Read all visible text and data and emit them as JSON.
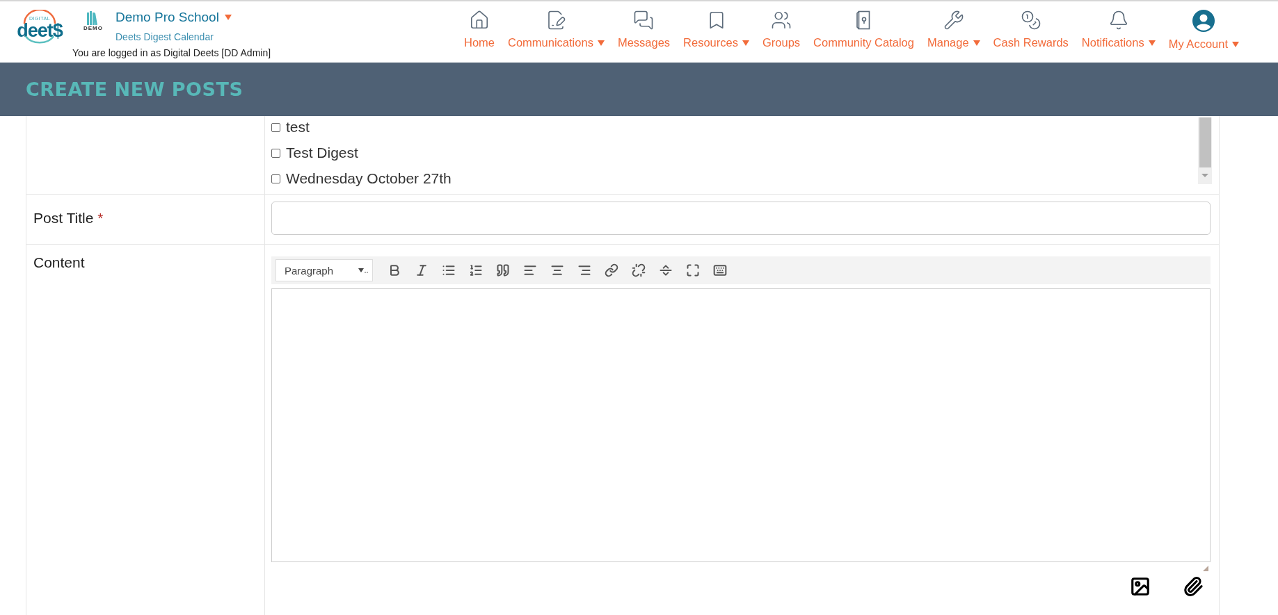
{
  "brand": {
    "logo_small": "DIGITAL",
    "logo_main": "deet$",
    "org_logo": "DEMO"
  },
  "header": {
    "school": "Demo Pro School",
    "school_dropdown": true,
    "subtitle": "Deets Digest Calendar",
    "login_note": "You are logged in as Digital Deets [DD Admin]"
  },
  "nav": [
    {
      "kind": "home",
      "label": "Home",
      "dropdown": false
    },
    {
      "kind": "communications",
      "label": "Communications",
      "dropdown": true
    },
    {
      "kind": "messages",
      "label": "Messages",
      "dropdown": false
    },
    {
      "kind": "resources",
      "label": "Resources",
      "dropdown": true
    },
    {
      "kind": "groups",
      "label": "Groups",
      "dropdown": false
    },
    {
      "kind": "catalog",
      "label": "Community Catalog",
      "dropdown": false
    },
    {
      "kind": "manage",
      "label": "Manage",
      "dropdown": true
    },
    {
      "kind": "rewards",
      "label": "Cash Rewards",
      "dropdown": false
    },
    {
      "kind": "notifications",
      "label": "Notifications",
      "dropdown": true
    },
    {
      "kind": "account",
      "label": "My Account",
      "dropdown": true
    }
  ],
  "banner": {
    "title": "CREATE NEW POSTS"
  },
  "digest_options": [
    {
      "label": "test",
      "checked": false
    },
    {
      "label": "Test Digest",
      "checked": false
    },
    {
      "label": "Wednesday October 27th",
      "checked": false
    }
  ],
  "post_title": {
    "label": "Post Title",
    "required_mark": "*"
  },
  "content": {
    "label": "Content",
    "format_select": "Paragraph",
    "toolbar": [
      {
        "kind": "bold"
      },
      {
        "kind": "italic"
      },
      {
        "kind": "bullet-list"
      },
      {
        "kind": "numbered-list"
      },
      {
        "kind": "quote"
      },
      {
        "kind": "align-left"
      },
      {
        "kind": "align-center"
      },
      {
        "kind": "align-right"
      },
      {
        "kind": "link"
      },
      {
        "kind": "unlink"
      },
      {
        "kind": "read-more"
      },
      {
        "kind": "fullscreen"
      },
      {
        "kind": "toolbar-toggle"
      }
    ]
  },
  "attachments": [
    {
      "kind": "image"
    },
    {
      "kind": "file"
    }
  ]
}
